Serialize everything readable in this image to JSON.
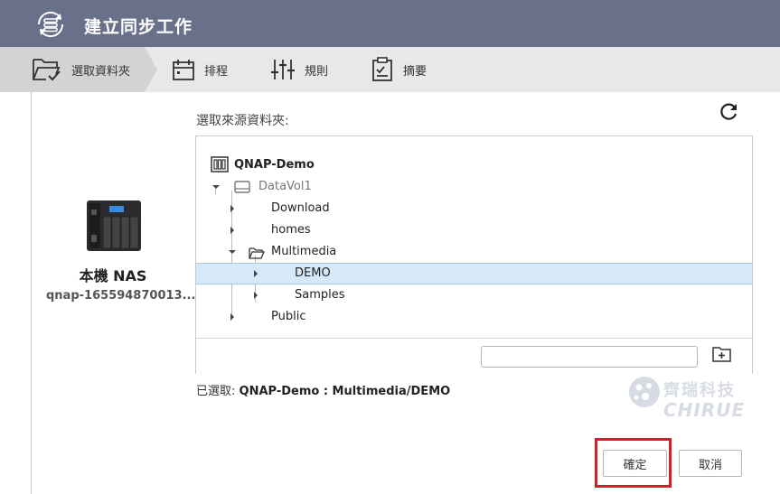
{
  "window": {
    "title": "建立同步工作"
  },
  "steps": [
    {
      "label": "選取資料夾",
      "icon": "folder-check-icon",
      "active": true
    },
    {
      "label": "排程",
      "icon": "calendar-icon",
      "active": false
    },
    {
      "label": "規則",
      "icon": "sliders-icon",
      "active": false
    },
    {
      "label": "摘要",
      "icon": "clipboard-icon",
      "active": false
    }
  ],
  "nas": {
    "name": "本機 NAS",
    "hostname": "qnap-165594870013..."
  },
  "source": {
    "label": "選取來源資料夾:"
  },
  "tree": {
    "root": "QNAP-Demo",
    "volume": "DataVol1",
    "items": [
      {
        "label": "Download"
      },
      {
        "label": "homes"
      },
      {
        "label": "Multimedia"
      },
      {
        "label": "DEMO"
      },
      {
        "label": "Samples"
      },
      {
        "label": "Public"
      }
    ],
    "new_folder_value": ""
  },
  "selection": {
    "prefix": "已選取:",
    "path": "QNAP-Demo : Multimedia/DEMO"
  },
  "watermark": {
    "cn": "齊瑞科技",
    "en": "CHIRUE"
  },
  "buttons": {
    "ok": "確定",
    "cancel": "取消"
  },
  "colors": {
    "titlebar": "#697089",
    "selected_row": "#d6e9f8",
    "highlight_box": "#d2202a"
  }
}
